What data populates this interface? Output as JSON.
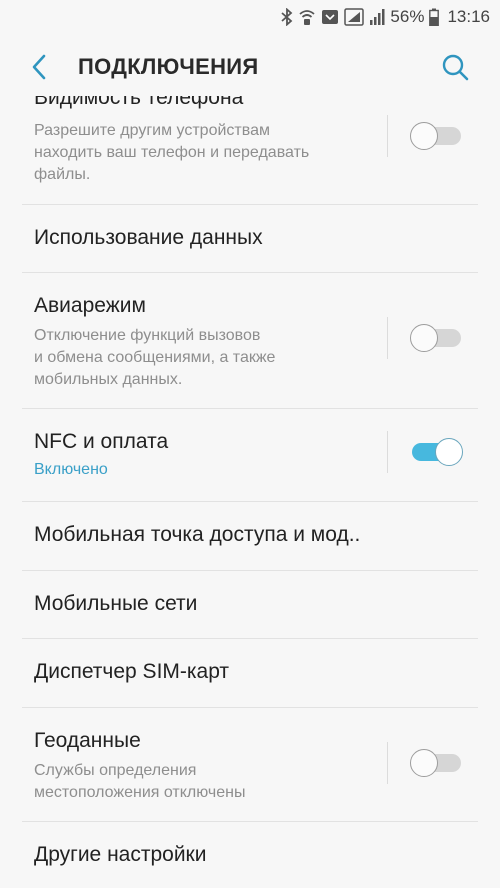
{
  "status_bar": {
    "battery_percent": "56%",
    "time": "13:16",
    "icons": [
      "bluetooth-icon",
      "wifi-calling-icon",
      "message-icon",
      "sim1-signal-icon",
      "signal-icon",
      "battery-icon"
    ]
  },
  "header": {
    "title": "ПОДКЛЮЧЕНИЯ",
    "icons": [
      "back-arrow-icon",
      "search-icon"
    ]
  },
  "colors": {
    "accent": "#3aa0c8",
    "toggle_on": "#47b8de",
    "background": "#f7f7f7"
  },
  "items": [
    {
      "title": "Видимость телефона",
      "subtitle": [
        "Разрешите другим устройствам",
        "находить ваш телефон и передавать",
        "файлы."
      ],
      "toggle": "off"
    },
    {
      "title": "Использование данных"
    },
    {
      "title": "Авиарежим",
      "subtitle": [
        "Отключение функций вызовов",
        "и обмена сообщениями, а также",
        "мобильных данных."
      ],
      "toggle": "off"
    },
    {
      "title": "NFC и оплата",
      "status": "Включено",
      "toggle": "on"
    },
    {
      "title": "Мобильная точка доступа и мод.."
    },
    {
      "title": "Мобильные сети"
    },
    {
      "title": "Диспетчер SIM-карт"
    },
    {
      "title": "Геоданные",
      "subtitle": [
        "Службы определения",
        "местоположения отключены"
      ],
      "toggle": "off"
    },
    {
      "title": "Другие настройки"
    }
  ]
}
